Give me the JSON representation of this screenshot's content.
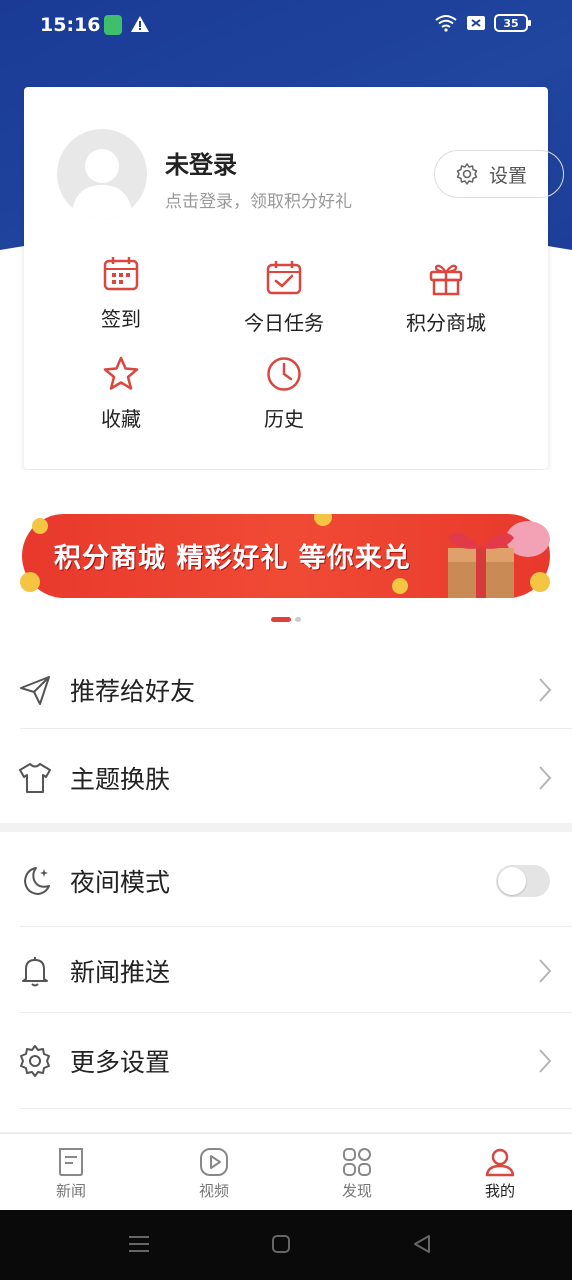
{
  "status_bar": {
    "time": "15:16",
    "battery": "35"
  },
  "profile": {
    "name": "未登录",
    "subtitle": "点击登录，领取积分好礼",
    "settings_label": "设置"
  },
  "quick_actions": [
    {
      "label": "签到",
      "icon": "calendar-icon"
    },
    {
      "label": "今日任务",
      "icon": "calendar-check-icon"
    },
    {
      "label": "积分商城",
      "icon": "gift-icon"
    },
    {
      "label": "收藏",
      "icon": "star-icon"
    },
    {
      "label": "历史",
      "icon": "clock-icon"
    }
  ],
  "banner": {
    "text": "积分商城 精彩好礼 等你来兑",
    "page_count": 2,
    "active_page": 1
  },
  "menu_group_1": [
    {
      "label": "推荐给好友",
      "icon": "send-icon"
    },
    {
      "label": "主题换肤",
      "icon": "tshirt-icon"
    }
  ],
  "menu_group_2": [
    {
      "label": "夜间模式",
      "icon": "moon-icon",
      "toggle": false
    },
    {
      "label": "新闻推送",
      "icon": "bell-icon"
    },
    {
      "label": "更多设置",
      "icon": "gear-icon"
    }
  ],
  "tabbar": [
    {
      "label": "新闻",
      "icon": "news-icon",
      "active": false
    },
    {
      "label": "视频",
      "icon": "video-icon",
      "active": false
    },
    {
      "label": "发现",
      "icon": "discover-icon",
      "active": false
    },
    {
      "label": "我的",
      "icon": "profile-icon",
      "active": true
    }
  ],
  "colors": {
    "brand_blue": "#1e3f9a",
    "accent_red": "#e0403a",
    "icon_red": "#d9473f"
  }
}
